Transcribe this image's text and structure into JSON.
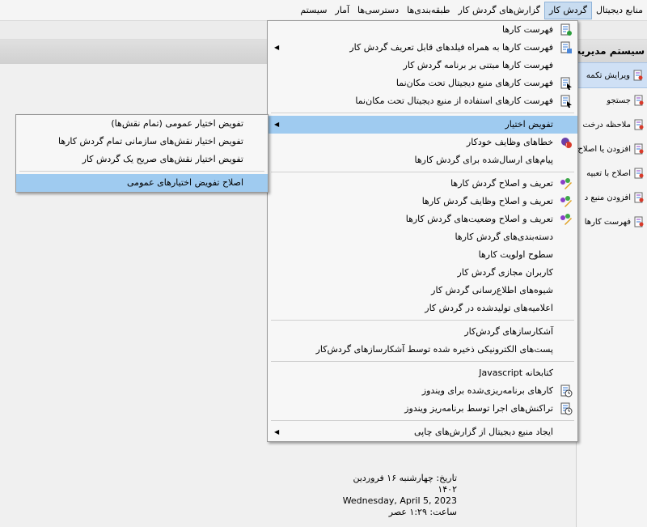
{
  "menubar": [
    {
      "label": "منابع دیجیتال",
      "active": false
    },
    {
      "label": "گردش کار",
      "active": true
    },
    {
      "label": "گزارش‌های گردش کار",
      "active": false
    },
    {
      "label": "طبقه‌بندی‌ها",
      "active": false
    },
    {
      "label": "دسترسی‌ها",
      "active": false
    },
    {
      "label": "آمار",
      "active": false
    },
    {
      "label": "سیستم",
      "active": false
    }
  ],
  "right_panel": {
    "title": "سیستم مدیریت",
    "items": [
      {
        "label": "ویرایش تکمه",
        "selected": true
      },
      {
        "label": "جستجو",
        "selected": false
      },
      {
        "label": "ملاحظه درخت",
        "selected": false
      },
      {
        "label": "افزودن یا اصلاح",
        "selected": false
      },
      {
        "label": "اصلاح با تعبیه",
        "selected": false
      },
      {
        "label": "افزودن منبع د",
        "selected": false
      },
      {
        "label": "فهرست کارها",
        "selected": false
      }
    ]
  },
  "main_menu": {
    "groups": [
      [
        {
          "label": "فهرست کارها",
          "icon": "list-doc-icon",
          "arrow": false
        },
        {
          "label": "فهرست کارها به همراه فیلدهای قابل تعریف گردش کار",
          "icon": "list-fields-icon",
          "arrow": true
        },
        {
          "label": "فهرست کارها مبتنی بر برنامه گردش کار",
          "icon": "",
          "arrow": false
        },
        {
          "label": "فهرست کارهای منبع دیجیتال تحت مکان‌نما",
          "icon": "cursor-list-icon",
          "arrow": false
        },
        {
          "label": "فهرست کارهای استفاده از منبع دیجیتال تحت مکان‌نما",
          "icon": "cursor-use-icon",
          "arrow": false
        }
      ],
      [
        {
          "label": "تفویض اختیار",
          "icon": "",
          "arrow": true,
          "highlight": true
        },
        {
          "label": "خطاهای وظایف خودکار",
          "icon": "error-task-icon",
          "arrow": false
        },
        {
          "label": "پیام‌های ارسال‌شده برای گردش کارها",
          "icon": "",
          "arrow": false
        }
      ],
      [
        {
          "label": "تعریف و اصلاح گردش کارها",
          "icon": "edit-flow-icon",
          "arrow": false
        },
        {
          "label": "تعریف و اصلاح وظایف گردش کارها",
          "icon": "edit-task-icon",
          "arrow": false
        },
        {
          "label": "تعریف و اصلاح وضعیت‌های گردش کارها",
          "icon": "edit-state-icon",
          "arrow": false
        },
        {
          "label": "دسته‌بندی‌های گردش کارها",
          "icon": "",
          "arrow": false
        },
        {
          "label": "سطوح اولویت کارها",
          "icon": "",
          "arrow": false
        },
        {
          "label": "کاربران مجازی گردش کار",
          "icon": "",
          "arrow": false
        },
        {
          "label": "شیوه‌های اطلاع‌رسانی گردش کار",
          "icon": "",
          "arrow": false
        },
        {
          "label": "اعلامیه‌های تولیدشده در گردش کار",
          "icon": "",
          "arrow": false
        }
      ],
      [
        {
          "label": "آشکارسازهای گردش‌کار",
          "icon": "",
          "arrow": false
        },
        {
          "label": "پست‌های الکترونیکی ذخیره شده توسط آشکارسازهای گردش‌کار",
          "icon": "",
          "arrow": false
        }
      ],
      [
        {
          "label": "کتابخانه Javascript",
          "icon": "",
          "arrow": false
        },
        {
          "label": "کارهای برنامه‌ریزی‌شده برای ویندوز",
          "icon": "scheduled-task-icon",
          "arrow": false
        },
        {
          "label": "تراکنش‌های اجرا توسط برنامه‌ریز ویندوز",
          "icon": "scheduler-log-icon",
          "arrow": false
        }
      ],
      [
        {
          "label": "ایجاد منبع دیجیتال از گزارش‌های چاپی",
          "icon": "",
          "arrow": true
        }
      ]
    ]
  },
  "sub_menu": {
    "groups": [
      [
        {
          "label": "تفویض اختیار عمومی (تمام نقش‌ها)"
        },
        {
          "label": "تفویض اختیار نقش‌های سازمانی تمام گردش کارها"
        },
        {
          "label": "تفویض اختیار نقش‌های صریح یک گردش کار"
        }
      ],
      [
        {
          "label": "اصلاح تفویض اختیارهای عمومی",
          "highlight": true
        }
      ]
    ]
  },
  "datebox": {
    "date_label": "تاریخ:",
    "date_fa": "چهارشنبه ۱۶ فروردین ۱۴۰۲",
    "date_en": "Wednesday, April 5, 2023",
    "time_label": "ساعت:",
    "time_value": "۱:۲۹ عصر"
  }
}
